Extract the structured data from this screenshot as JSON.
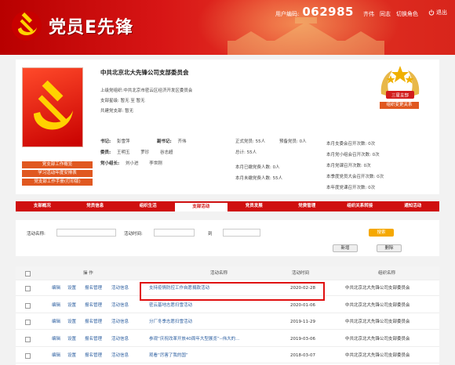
{
  "header": {
    "app_title": "党员E先锋",
    "user_code_label": "用户编码:",
    "user_code": "062985",
    "user_name": "齐伟",
    "role": "同志",
    "switch_role": "切换角色",
    "exit": "退出",
    "brand_color": "#d71515"
  },
  "profile": {
    "org_name": "中共北京北大先锋公司支部委员会",
    "parent_org": "上级党组织:中共北京市密云区经济开发区委员会",
    "branch_title": "支部星级:",
    "branch_title_value": "暂无",
    "branch_level": "至",
    "branch_level_value": "暂无",
    "build_branch": "共建党支部:",
    "build_branch_value": "暂无",
    "side_buttons": [
      "党支部工作概览",
      "学习活动年度安排表",
      "党支部工作手册(打印版)"
    ],
    "star_badge": "三星支部",
    "relation_button": "组织变更关系",
    "secretary_label": "书记:",
    "secretary": "彭雪萍",
    "deputy_label": "副书记:",
    "deputy": "齐伟",
    "committee_label": "委员:",
    "committee": [
      "王明玉",
      "罗珍",
      "谷志超"
    ],
    "group_leader_label": "党小组长:",
    "group_leaders": [
      "刘小进",
      "李世刚"
    ],
    "formal_members": "正式党员: 55人",
    "probationary": "预备党员: 0人",
    "total": "总计: 55人",
    "transferred_in": "本月已缴党费人数: 0人",
    "not_paid": "本月未缴党费人数: 55人",
    "stats": [
      "本月支委会召开次数: 0次",
      "本月党小组会召开次数: 0次",
      "本月党课召开次数: 0次",
      "本季度党员大会召开次数: 0次",
      "本年度党课召开次数: 0次"
    ]
  },
  "tabs": [
    "支部概况",
    "党员信息",
    "组织生活",
    "支部活动",
    "党员发展",
    "党费管理",
    "组织关系转接",
    "通知活动"
  ],
  "active_tab": 3,
  "search": {
    "name_label": "活动名称:",
    "time_label": "活动时间:",
    "to_label": "到",
    "search_button": "搜索",
    "add_button": "新增",
    "delete_button": "删除"
  },
  "table": {
    "headers": [
      "操 作",
      "活动名称",
      "活动时间",
      "组织名称"
    ],
    "op_labels": [
      "编辑",
      "设置",
      "报名管理",
      "活动信息"
    ],
    "rows": [
      {
        "name": "支持疫情防控工作自愿捐款活动",
        "date": "2020-02-28",
        "org": "中共北京北大先锋公司支部委员会"
      },
      {
        "name": "密云基地志愿扫雪活动",
        "date": "2020-01-06",
        "org": "中共北京北大先锋公司支部委员会"
      },
      {
        "name": "分厂冬季志愿扫雪活动",
        "date": "2019-11-29",
        "org": "中共北京北大先锋公司支部委员会"
      },
      {
        "name": "参观“庆祝改革开放40周年大型展览”--伟大的…",
        "date": "2019-03-06",
        "org": "中共北京北大先锋公司支部委员会"
      },
      {
        "name": "观看“厉害了我的国”",
        "date": "2018-03-07",
        "org": "中共北京北大先锋公司支部委员会"
      }
    ]
  }
}
